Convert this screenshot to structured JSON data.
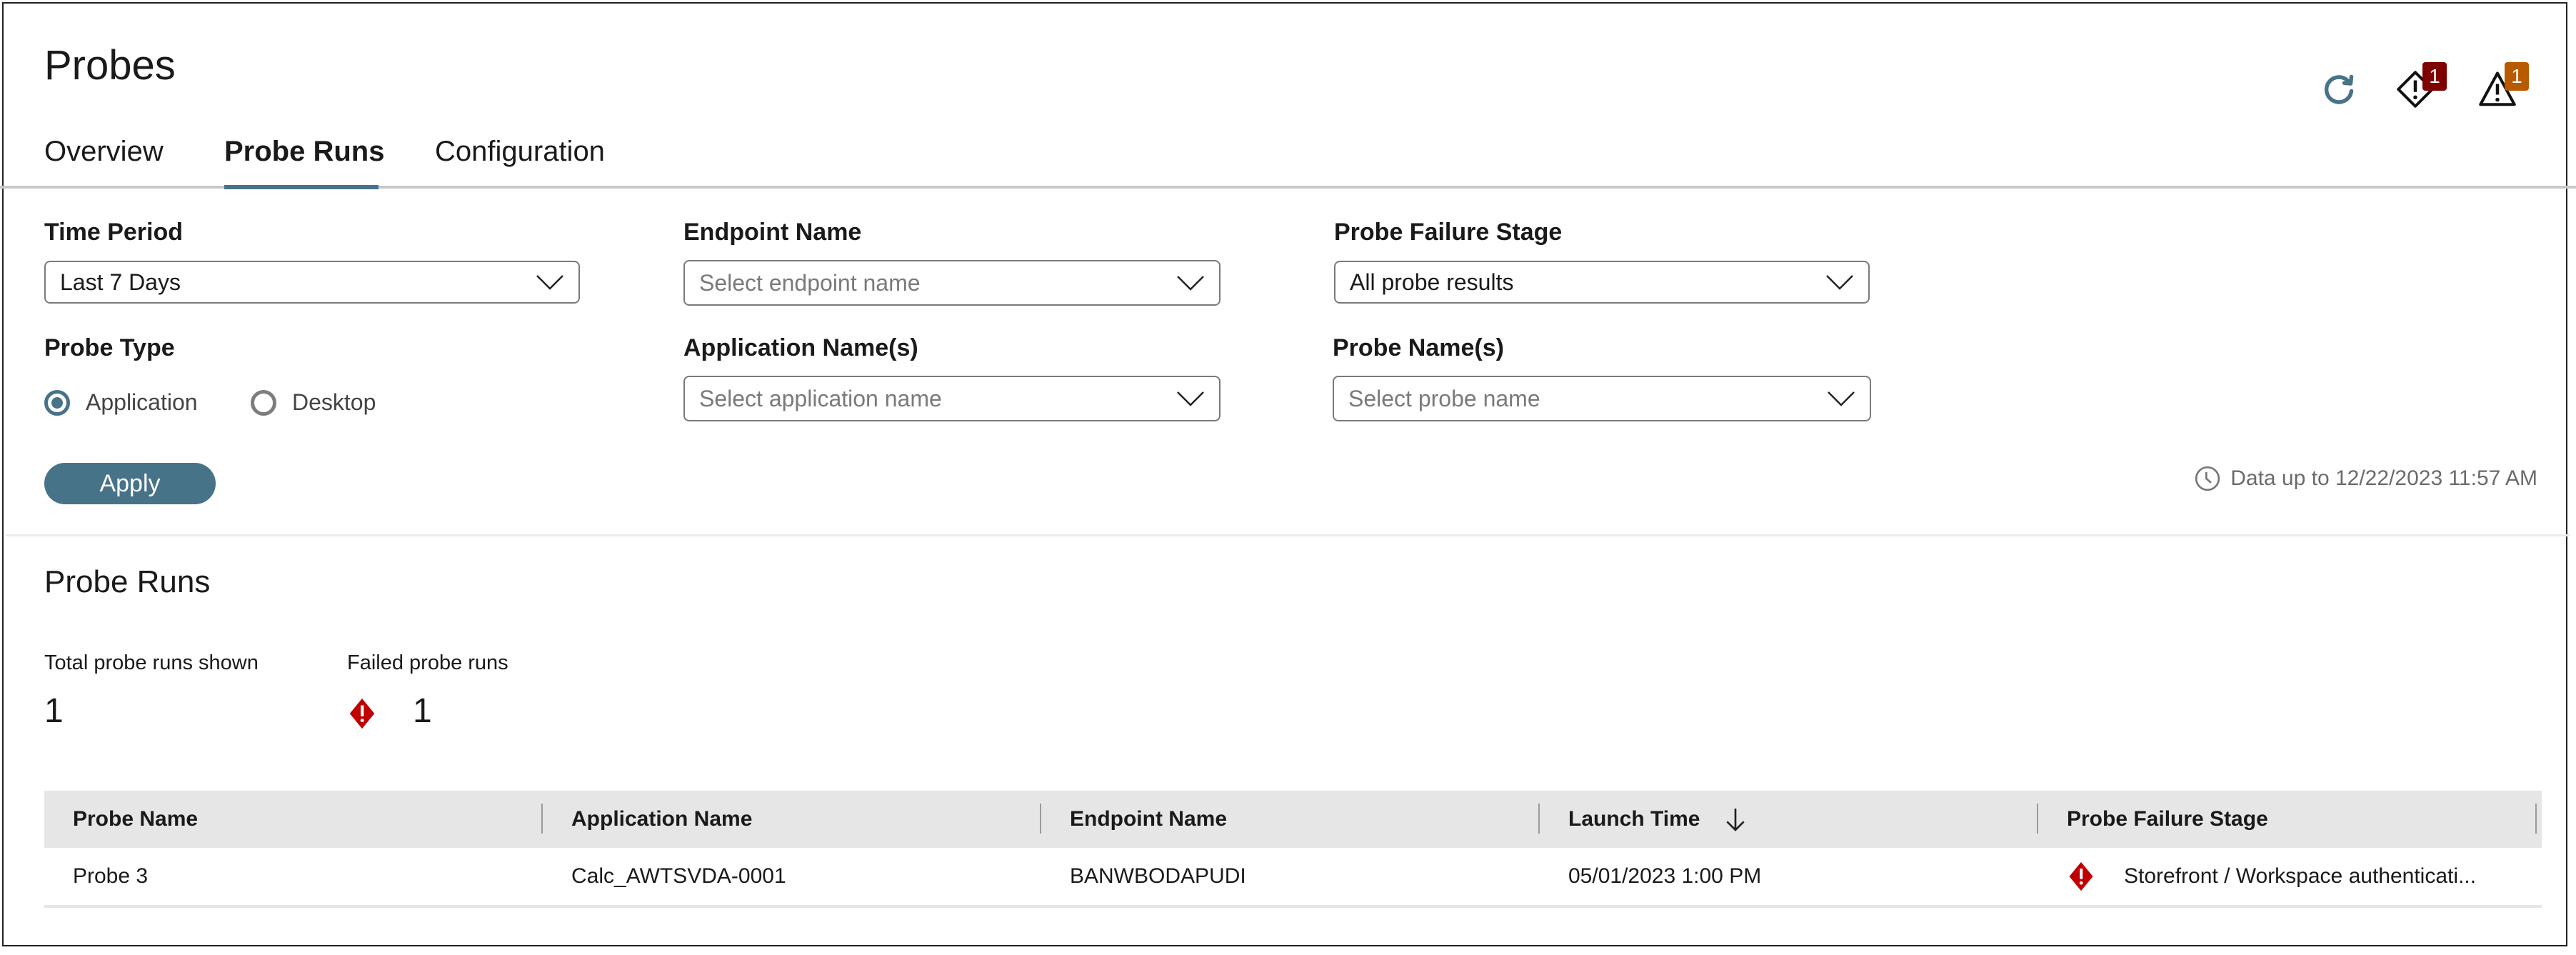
{
  "page": {
    "title": "Probes"
  },
  "tabs": [
    {
      "label": "Overview",
      "active": false
    },
    {
      "label": "Probe Runs",
      "active": true
    },
    {
      "label": "Configuration",
      "active": false
    }
  ],
  "header_icons": {
    "refresh": {
      "icon": "refresh-icon",
      "color": "#477389"
    },
    "failures": {
      "icon": "diamond-alert-icon",
      "count": "1",
      "badge_color": "#7f0000"
    },
    "warnings": {
      "icon": "warning-triangle-icon",
      "count": "1",
      "badge_color": "#b85a00"
    }
  },
  "filters": {
    "time_period": {
      "label": "Time Period",
      "value": "Last 7 Days"
    },
    "endpoint_name": {
      "label": "Endpoint Name",
      "placeholder": "Select endpoint name"
    },
    "probe_failure_stage": {
      "label": "Probe Failure Stage",
      "value": "All probe results"
    },
    "probe_type": {
      "label": "Probe Type",
      "options": [
        {
          "label": "Application",
          "selected": true
        },
        {
          "label": "Desktop",
          "selected": false
        }
      ]
    },
    "application_names": {
      "label": "Application Name(s)",
      "placeholder": "Select application name"
    },
    "probe_names": {
      "label": "Probe Name(s)",
      "placeholder": "Select probe name"
    },
    "apply_label": "Apply",
    "data_up_to": "Data up to 12/22/2023 11:57 AM"
  },
  "probe_runs": {
    "title": "Probe Runs",
    "total_label": "Total probe runs shown",
    "total_value": "1",
    "failed_label": "Failed probe runs",
    "failed_value": "1",
    "columns": [
      "Probe Name",
      "Application Name",
      "Endpoint Name",
      "Launch Time",
      "Probe Failure Stage"
    ],
    "sort": {
      "column": "Launch Time",
      "direction": "descending"
    },
    "rows": [
      {
        "probe_name": "Probe 3",
        "application_name": "Calc_AWTSVDA-0001",
        "endpoint_name": "BANWBODAPUDI",
        "launch_time": "05/01/2023 1:00 PM",
        "failure_stage": "Storefront / Workspace authenticati..."
      }
    ]
  },
  "colors": {
    "accent": "#477389",
    "error": "#c00000"
  }
}
